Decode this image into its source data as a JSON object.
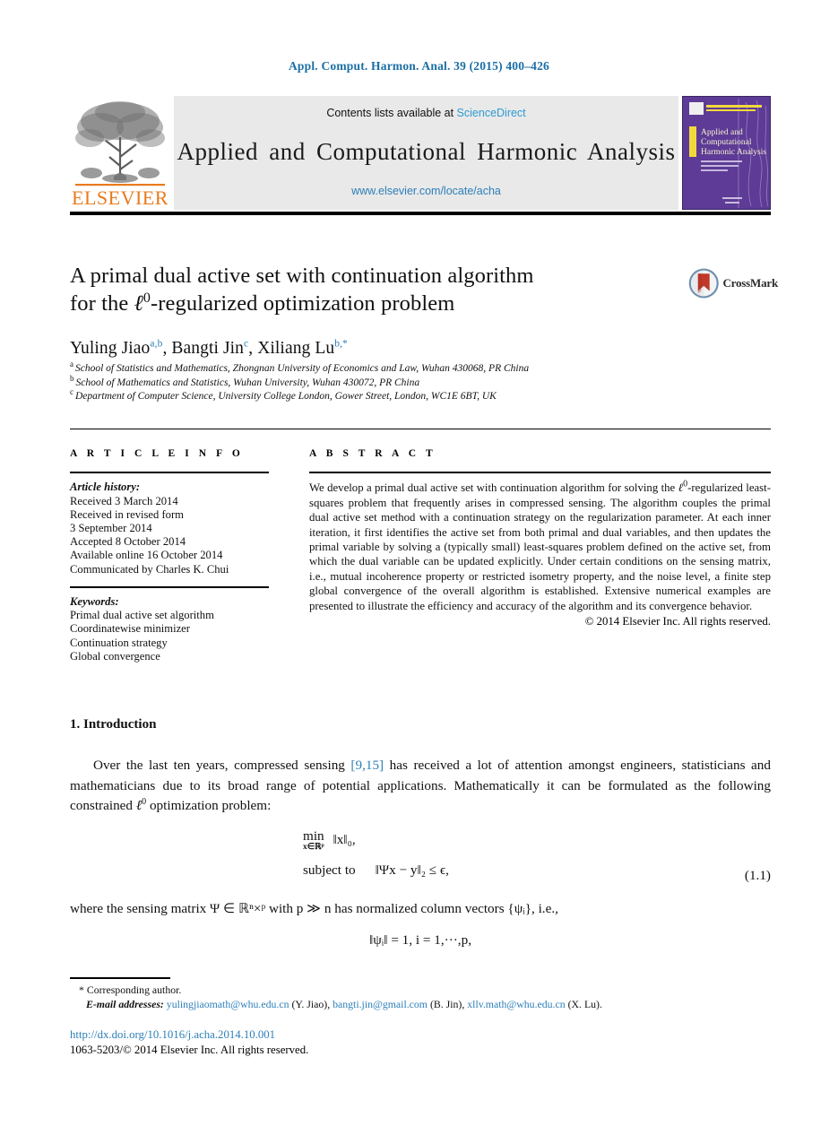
{
  "running_head": "Appl. Comput. Harmon. Anal. 39 (2015) 400–426",
  "masthead": {
    "publisher_logo_text": "ELSEVIER",
    "contents_prefix": "Contents lists available at ",
    "contents_link": "ScienceDirect",
    "journal_title": "Applied and Computational Harmonic Analysis",
    "journal_url": "www.elsevier.com/locate/acha",
    "cover_title_lines": [
      "Applied and",
      "Computational",
      "Harmonic Analysis"
    ]
  },
  "article": {
    "title_line1": "A primal dual active set with continuation algorithm",
    "title_line2_pre": "for the ",
    "title_line2_ell": "ℓ",
    "title_line2_sup": "0",
    "title_line2_post": "-regularized optimization problem",
    "authors_plain": "Yuling Jiao a,b, Bangti Jin c, Xiliang Lu b,*",
    "authors": [
      {
        "name": "Yuling Jiao",
        "marks": "a,b"
      },
      {
        "name": "Bangti Jin",
        "marks": "c"
      },
      {
        "name": "Xiliang Lu",
        "marks": "b,*"
      }
    ],
    "affiliations": [
      {
        "letter": "a",
        "text": "School of Statistics and Mathematics, Zhongnan University of Economics and Law, Wuhan 430068, PR China"
      },
      {
        "letter": "b",
        "text": "School of Mathematics and Statistics, Wuhan University, Wuhan 430072, PR China"
      },
      {
        "letter": "c",
        "text": "Department of Computer Science, University College London, Gower Street, London, WC1E 6BT, UK"
      }
    ],
    "crossmark_label": "CrossMark"
  },
  "info": {
    "heading": "A R T I C L E    I N F O",
    "history_label": "Article history:",
    "history": [
      "Received 3 March 2014",
      "Received in revised form",
      "3 September 2014",
      "Accepted 8 October 2014",
      "Available online 16 October 2014",
      "Communicated by Charles K. Chui"
    ],
    "keywords_label": "Keywords:",
    "keywords": [
      "Primal dual active set algorithm",
      "Coordinatewise minimizer",
      "Continuation strategy",
      "Global convergence"
    ]
  },
  "abstract": {
    "heading": "A B S T R A C T",
    "part1": "We develop a primal dual active set with continuation algorithm for solving the ",
    "ell": "ℓ",
    "ell_sup": "0",
    "part2": "-regularized least-squares problem that frequently arises in compressed sensing. The algorithm couples the primal dual active set method with a continuation strategy on the regularization parameter. At each inner iteration, it first identifies the active set from both primal and dual variables, and then updates the primal variable by solving a (typically small) least-squares problem defined on the active set, from which the dual variable can be updated explicitly. Under certain conditions on the sensing matrix, i.e., mutual incoherence property or restricted isometry property, and the noise level, a finite step global convergence of the overall algorithm is established. Extensive numerical examples are presented to illustrate the efficiency and accuracy of the algorithm and its convergence behavior.",
    "copyright": "© 2014 Elsevier Inc. All rights reserved."
  },
  "body": {
    "section_number_title": "1. Introduction",
    "para1_a": "Over the last ten years, compressed sensing ",
    "para1_cite": "[9,15]",
    "para1_b": " has received a lot of attention amongst engineers, statisticians and mathematicians due to its broad range of potential applications. Mathematically it can be formulated as the following constrained ",
    "para1_ell": "ℓ",
    "para1_ell_sup": "0",
    "para1_c": " optimization problem:",
    "equation": {
      "min_op": "min",
      "min_sub": "x∈ℝᵖ",
      "min_body": "‖x‖₀,",
      "subject_label": "subject to",
      "subject_body": "‖Ψx − y‖₂ ≤ ϵ,",
      "number": "(1.1)"
    },
    "para2": "where the sensing matrix Ψ ∈ ℝⁿ×ᵖ with p ≫ n has normalized column vectors {ψᵢ}, i.e.,",
    "equation2": "‖ψᵢ‖ = 1,   i = 1,···,p,"
  },
  "footnote": {
    "corresponding": "* Corresponding author.",
    "email_label": "E-mail addresses:",
    "emails": [
      {
        "address": "yulingjiaomath@whu.edu.cn",
        "owner": "(Y. Jiao)"
      },
      {
        "address": "bangti.jin@gmail.com",
        "owner": "(B. Jin)"
      },
      {
        "address": "xllv.math@whu.edu.cn",
        "owner": "(X. Lu)"
      }
    ]
  },
  "bottom": {
    "doi": "http://dx.doi.org/10.1016/j.acha.2014.10.001",
    "issn_line": "1063-5203/© 2014 Elsevier Inc. All rights reserved."
  },
  "colors": {
    "link_blue": "#2d7fb8",
    "head_blue": "#1a6ea5",
    "elsevier_orange": "#E87B1E",
    "cover_purple": "#5d3b96"
  }
}
